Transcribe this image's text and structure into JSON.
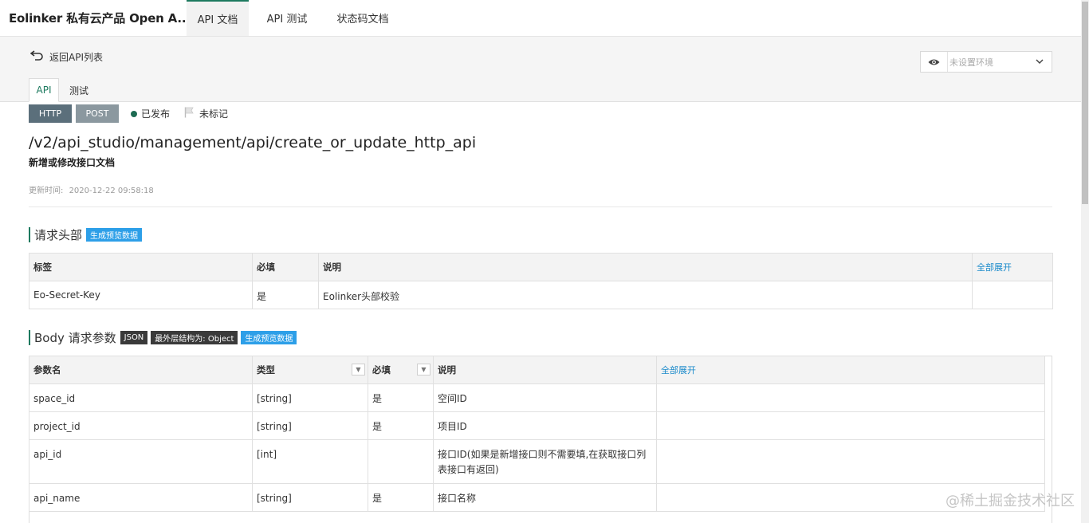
{
  "topbar": {
    "brand": "Eolinker 私有云产品 Open A...",
    "tabs": [
      "API 文档",
      "API 测试",
      "状态码文档"
    ]
  },
  "subheader": {
    "back_label": "返回API列表",
    "env_placeholder": "未设置环境",
    "tabs": [
      "API",
      "测试"
    ]
  },
  "api": {
    "protocol": "HTTP",
    "method": "POST",
    "status": "已发布",
    "mark": "未标记",
    "path": "/v2/api_studio/management/api/create_or_update_http_api",
    "desc": "新增或修改接口文档",
    "updated_label": "更新时间:",
    "updated_value": "2020-12-22 09:58:18"
  },
  "headers_section": {
    "title": "请求头部",
    "preview_tag": "生成预览数据",
    "columns": [
      "标签",
      "必填",
      "说明"
    ],
    "expand_all": "全部展开",
    "rows": [
      {
        "name": "Eo-Secret-Key",
        "required": "是",
        "desc": "Eolinker头部校验"
      }
    ]
  },
  "body_section": {
    "title": "Body 请求参数",
    "json_tag": "JSON",
    "struct_tag": "最外层结构为: Object",
    "preview_tag": "生成预览数据",
    "columns": [
      "参数名",
      "类型",
      "必填",
      "说明"
    ],
    "expand_all": "全部展开",
    "rows": [
      {
        "name": "space_id",
        "type": "[string]",
        "required": "是",
        "desc": "空间ID"
      },
      {
        "name": "project_id",
        "type": "[string]",
        "required": "是",
        "desc": "项目ID"
      },
      {
        "name": "api_id",
        "type": "[int]",
        "required": "",
        "desc": "接口ID(如果是新增接口则不需要填,在获取接口列表接口有返回)"
      },
      {
        "name": "api_name",
        "type": "[string]",
        "required": "是",
        "desc": "接口名称"
      }
    ]
  },
  "watermark": "@稀土掘金技术社区",
  "colors": {
    "accent": "#1d7a5f",
    "link": "#1a8acb",
    "tag_blue": "#2d9fe8"
  }
}
